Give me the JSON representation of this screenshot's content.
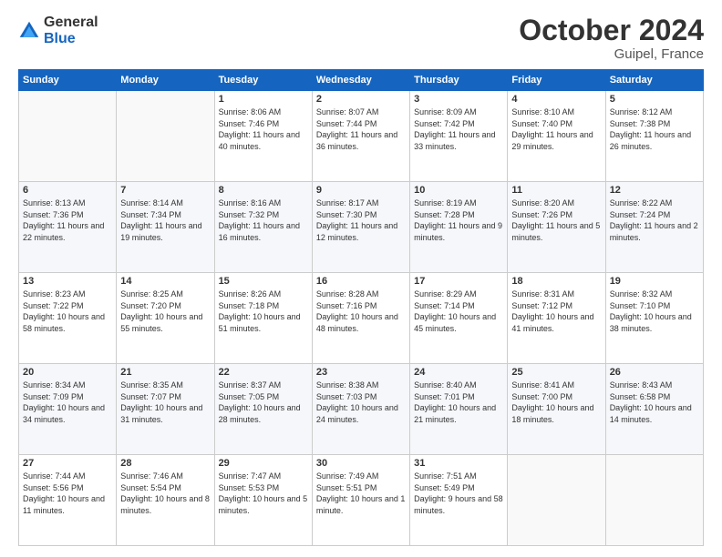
{
  "logo": {
    "general": "General",
    "blue": "Blue"
  },
  "header": {
    "month": "October 2024",
    "location": "Guipel, France"
  },
  "weekdays": [
    "Sunday",
    "Monday",
    "Tuesday",
    "Wednesday",
    "Thursday",
    "Friday",
    "Saturday"
  ],
  "weeks": [
    [
      {
        "day": "",
        "info": ""
      },
      {
        "day": "",
        "info": ""
      },
      {
        "day": "1",
        "info": "Sunrise: 8:06 AM\nSunset: 7:46 PM\nDaylight: 11 hours and 40 minutes."
      },
      {
        "day": "2",
        "info": "Sunrise: 8:07 AM\nSunset: 7:44 PM\nDaylight: 11 hours and 36 minutes."
      },
      {
        "day": "3",
        "info": "Sunrise: 8:09 AM\nSunset: 7:42 PM\nDaylight: 11 hours and 33 minutes."
      },
      {
        "day": "4",
        "info": "Sunrise: 8:10 AM\nSunset: 7:40 PM\nDaylight: 11 hours and 29 minutes."
      },
      {
        "day": "5",
        "info": "Sunrise: 8:12 AM\nSunset: 7:38 PM\nDaylight: 11 hours and 26 minutes."
      }
    ],
    [
      {
        "day": "6",
        "info": "Sunrise: 8:13 AM\nSunset: 7:36 PM\nDaylight: 11 hours and 22 minutes."
      },
      {
        "day": "7",
        "info": "Sunrise: 8:14 AM\nSunset: 7:34 PM\nDaylight: 11 hours and 19 minutes."
      },
      {
        "day": "8",
        "info": "Sunrise: 8:16 AM\nSunset: 7:32 PM\nDaylight: 11 hours and 16 minutes."
      },
      {
        "day": "9",
        "info": "Sunrise: 8:17 AM\nSunset: 7:30 PM\nDaylight: 11 hours and 12 minutes."
      },
      {
        "day": "10",
        "info": "Sunrise: 8:19 AM\nSunset: 7:28 PM\nDaylight: 11 hours and 9 minutes."
      },
      {
        "day": "11",
        "info": "Sunrise: 8:20 AM\nSunset: 7:26 PM\nDaylight: 11 hours and 5 minutes."
      },
      {
        "day": "12",
        "info": "Sunrise: 8:22 AM\nSunset: 7:24 PM\nDaylight: 11 hours and 2 minutes."
      }
    ],
    [
      {
        "day": "13",
        "info": "Sunrise: 8:23 AM\nSunset: 7:22 PM\nDaylight: 10 hours and 58 minutes."
      },
      {
        "day": "14",
        "info": "Sunrise: 8:25 AM\nSunset: 7:20 PM\nDaylight: 10 hours and 55 minutes."
      },
      {
        "day": "15",
        "info": "Sunrise: 8:26 AM\nSunset: 7:18 PM\nDaylight: 10 hours and 51 minutes."
      },
      {
        "day": "16",
        "info": "Sunrise: 8:28 AM\nSunset: 7:16 PM\nDaylight: 10 hours and 48 minutes."
      },
      {
        "day": "17",
        "info": "Sunrise: 8:29 AM\nSunset: 7:14 PM\nDaylight: 10 hours and 45 minutes."
      },
      {
        "day": "18",
        "info": "Sunrise: 8:31 AM\nSunset: 7:12 PM\nDaylight: 10 hours and 41 minutes."
      },
      {
        "day": "19",
        "info": "Sunrise: 8:32 AM\nSunset: 7:10 PM\nDaylight: 10 hours and 38 minutes."
      }
    ],
    [
      {
        "day": "20",
        "info": "Sunrise: 8:34 AM\nSunset: 7:09 PM\nDaylight: 10 hours and 34 minutes."
      },
      {
        "day": "21",
        "info": "Sunrise: 8:35 AM\nSunset: 7:07 PM\nDaylight: 10 hours and 31 minutes."
      },
      {
        "day": "22",
        "info": "Sunrise: 8:37 AM\nSunset: 7:05 PM\nDaylight: 10 hours and 28 minutes."
      },
      {
        "day": "23",
        "info": "Sunrise: 8:38 AM\nSunset: 7:03 PM\nDaylight: 10 hours and 24 minutes."
      },
      {
        "day": "24",
        "info": "Sunrise: 8:40 AM\nSunset: 7:01 PM\nDaylight: 10 hours and 21 minutes."
      },
      {
        "day": "25",
        "info": "Sunrise: 8:41 AM\nSunset: 7:00 PM\nDaylight: 10 hours and 18 minutes."
      },
      {
        "day": "26",
        "info": "Sunrise: 8:43 AM\nSunset: 6:58 PM\nDaylight: 10 hours and 14 minutes."
      }
    ],
    [
      {
        "day": "27",
        "info": "Sunrise: 7:44 AM\nSunset: 5:56 PM\nDaylight: 10 hours and 11 minutes."
      },
      {
        "day": "28",
        "info": "Sunrise: 7:46 AM\nSunset: 5:54 PM\nDaylight: 10 hours and 8 minutes."
      },
      {
        "day": "29",
        "info": "Sunrise: 7:47 AM\nSunset: 5:53 PM\nDaylight: 10 hours and 5 minutes."
      },
      {
        "day": "30",
        "info": "Sunrise: 7:49 AM\nSunset: 5:51 PM\nDaylight: 10 hours and 1 minute."
      },
      {
        "day": "31",
        "info": "Sunrise: 7:51 AM\nSunset: 5:49 PM\nDaylight: 9 hours and 58 minutes."
      },
      {
        "day": "",
        "info": ""
      },
      {
        "day": "",
        "info": ""
      }
    ]
  ]
}
